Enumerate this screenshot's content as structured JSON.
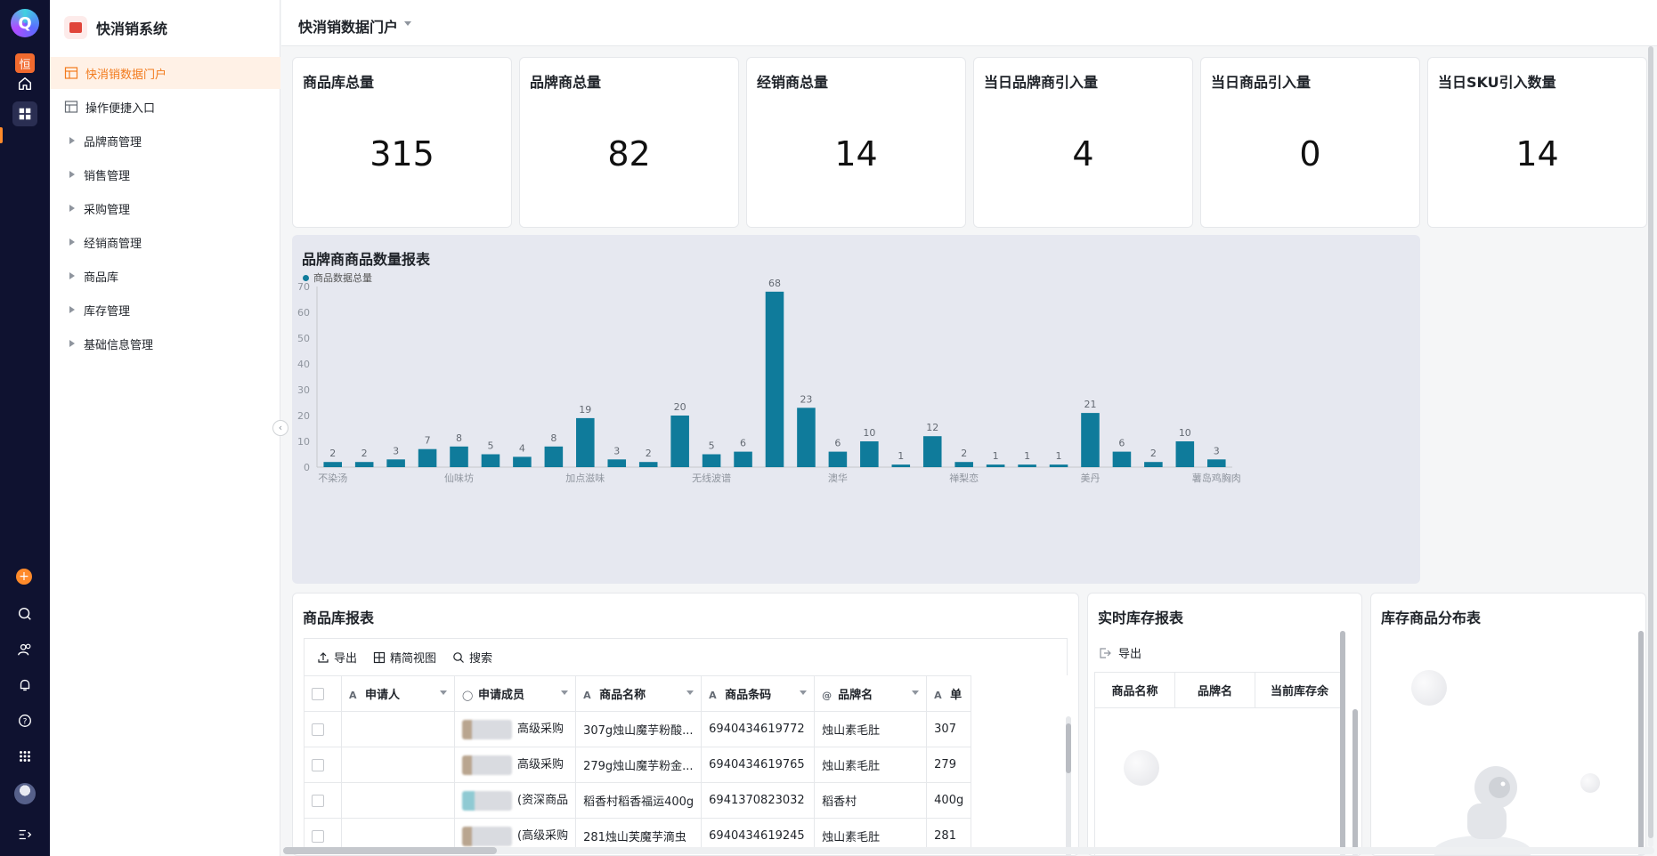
{
  "rail": {
    "logo_letter": "Q",
    "app_badge": "恒",
    "icons": [
      "home-icon",
      "grid-apps-icon",
      "add-circle-icon",
      "search-icon",
      "contacts-icon",
      "bell-icon",
      "help-icon",
      "apps-icon",
      "avatar",
      "expand-icon"
    ]
  },
  "sidebar": {
    "title": "快消销系统",
    "more": "···",
    "items": [
      {
        "label": "快消销数据门户",
        "type": "page",
        "active": true
      },
      {
        "label": "操作便捷入口",
        "type": "page",
        "active": false
      },
      {
        "label": "品牌商管理",
        "type": "folder"
      },
      {
        "label": "销售管理",
        "type": "folder"
      },
      {
        "label": "采购管理",
        "type": "folder"
      },
      {
        "label": "经销商管理",
        "type": "folder"
      },
      {
        "label": "商品库",
        "type": "folder"
      },
      {
        "label": "库存管理",
        "type": "folder"
      },
      {
        "label": "基础信息管理",
        "type": "folder"
      }
    ]
  },
  "header": {
    "title": "快消销数据门户"
  },
  "stats": [
    {
      "label": "商品库总量",
      "value": "315"
    },
    {
      "label": "品牌商总量",
      "value": "82"
    },
    {
      "label": "经销商总量",
      "value": "14"
    },
    {
      "label": "当日品牌商引入量",
      "value": "4"
    },
    {
      "label": "当日商品引入量",
      "value": "0"
    },
    {
      "label": "当日SKU引入数量",
      "value": "14"
    }
  ],
  "chart_title": "品牌商商品数量报表",
  "chart_data": {
    "type": "bar",
    "title": "品牌商商品数量报表",
    "legend": "top-left",
    "series": [
      {
        "name": "商品数据总量",
        "color": "#0f7b9b",
        "values": [
          2,
          2,
          3,
          7,
          8,
          5,
          4,
          8,
          19,
          3,
          2,
          20,
          5,
          6,
          68,
          23,
          6,
          10,
          1,
          12,
          2,
          1,
          1,
          1,
          21,
          6,
          2,
          10,
          3
        ]
      }
    ],
    "xtick_labels": [
      "不染汤",
      "仙味坊",
      "加点滋味",
      "无线波谱",
      "澳华",
      "禅梨恋",
      "美丹",
      "薯岛鸡胸肉"
    ],
    "xtick_indices": [
      0,
      4,
      8,
      12,
      16,
      20,
      24,
      28
    ],
    "ylim": [
      0,
      70
    ],
    "yticks": [
      0,
      10,
      20,
      30,
      40,
      50,
      60,
      70
    ],
    "grid": false
  },
  "product_report": {
    "title": "商品库报表",
    "toolbar": {
      "export": "导出",
      "view": "精简视图",
      "search": "搜索"
    },
    "columns": [
      "申请人",
      "申请成员",
      "商品名称",
      "商品条码",
      "品牌名",
      "单"
    ],
    "rows": [
      {
        "applicant": "",
        "member": "高级采购",
        "name": "307g烛山魔芋粉酸...",
        "barcode": "6940434619772",
        "brand": "烛山素毛肚",
        "unit": "307"
      },
      {
        "applicant": "",
        "member": "高级采购",
        "name": "279g烛山魔芋粉金...",
        "barcode": "6940434619765",
        "brand": "烛山素毛肚",
        "unit": "279"
      },
      {
        "applicant": "",
        "member": "(资深商品",
        "name": "稻香村稻香福运400g",
        "barcode": "6941370823032",
        "brand": "稻香村",
        "unit": "400g"
      },
      {
        "applicant": "",
        "member": "(高级采购",
        "name": "281烛山芙魔芋滴虫",
        "barcode": "6940434619245",
        "brand": "烛山素毛肚",
        "unit": "281"
      }
    ]
  },
  "inventory_report": {
    "title": "实时库存报表",
    "export": "导出",
    "columns": [
      "商品名称",
      "品牌名",
      "当前库存余"
    ]
  },
  "distribution": {
    "title": "库存商品分布表"
  }
}
